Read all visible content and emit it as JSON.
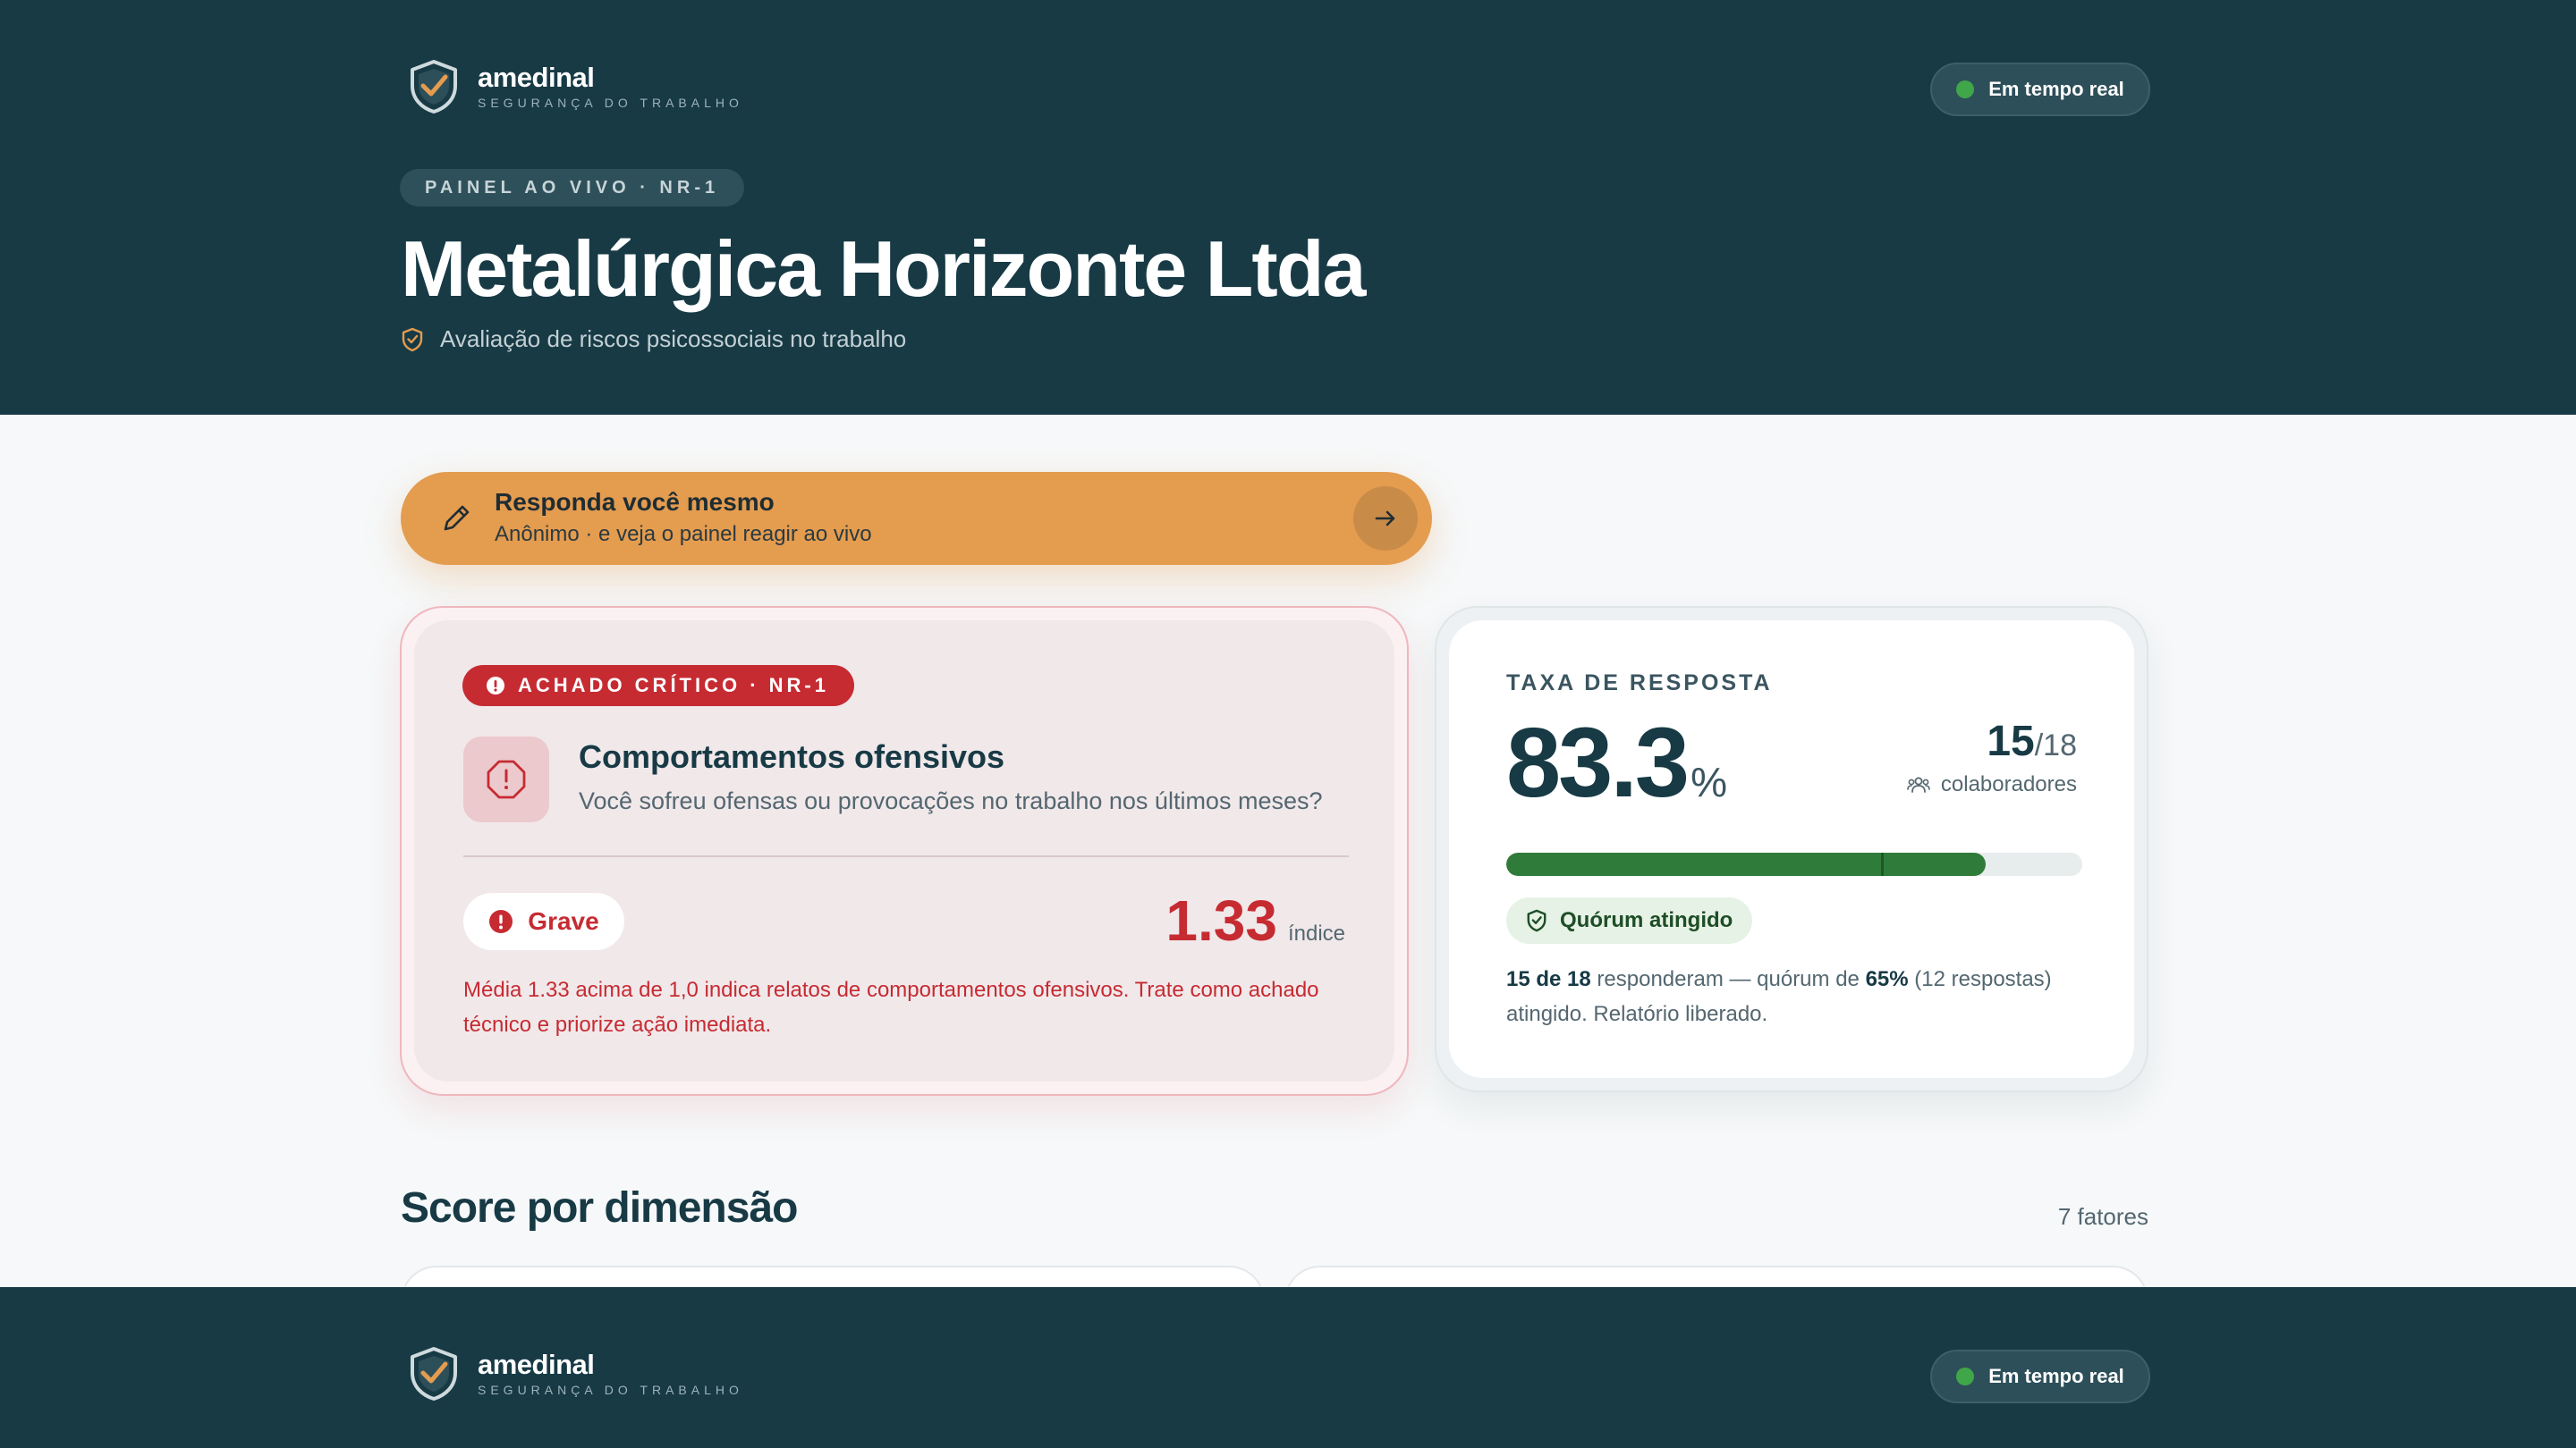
{
  "brand": {
    "name": "amedinal",
    "tagline": "SEGURANÇA DO TRABALHO"
  },
  "live_status": {
    "label": "Em tempo real",
    "dot_color": "#3fa64a"
  },
  "hero": {
    "kicker": "PAINEL AO VIVO · NR-1",
    "company": "Metalúrgica Horizonte Ltda",
    "subtitle": "Avaliação de riscos psicossociais no trabalho",
    "icon": "shield-check-icon"
  },
  "cta": {
    "title": "Responda você mesmo",
    "subtitle": "Anônimo · e veja o painel reagir ao vivo",
    "icon": "pencil-icon",
    "arrow_icon": "arrow-right-icon",
    "color": "#e49c4f"
  },
  "critical": {
    "badge": "ACHADO CRÍTICO · NR-1",
    "title": "Comportamentos ofensivos",
    "question": "Você sofreu ofensas ou provocações no trabalho nos últimos meses?",
    "severity": "Grave",
    "score": "1.33",
    "score_label": "índice",
    "note": "Média 1.33 acima de 1,0 indica relatos de comportamentos ofensivos. Trate como achado técnico e priorize ação imediata.",
    "icon": "alert-octagon-icon",
    "color": "#c62b32"
  },
  "response": {
    "label": "TAXA DE RESPOSTA",
    "rate": "83.3",
    "rate_unit": "%",
    "rate_fraction": 0.833,
    "quorum_fraction": 0.65,
    "responded": "15",
    "total": "/18",
    "people_label": "colaboradores",
    "quorum_label": "Quórum atingido",
    "note": {
      "responded_text": "15 de 18",
      "mid_1": " responderam — quórum de ",
      "quorum_pct": "65%",
      "mid_2": " (12 respostas) atingido. Relatório liberado."
    },
    "bar_color": "#2f7b3a"
  },
  "dimensions": {
    "title": "Score por dimensão",
    "count": "7 fatores"
  }
}
